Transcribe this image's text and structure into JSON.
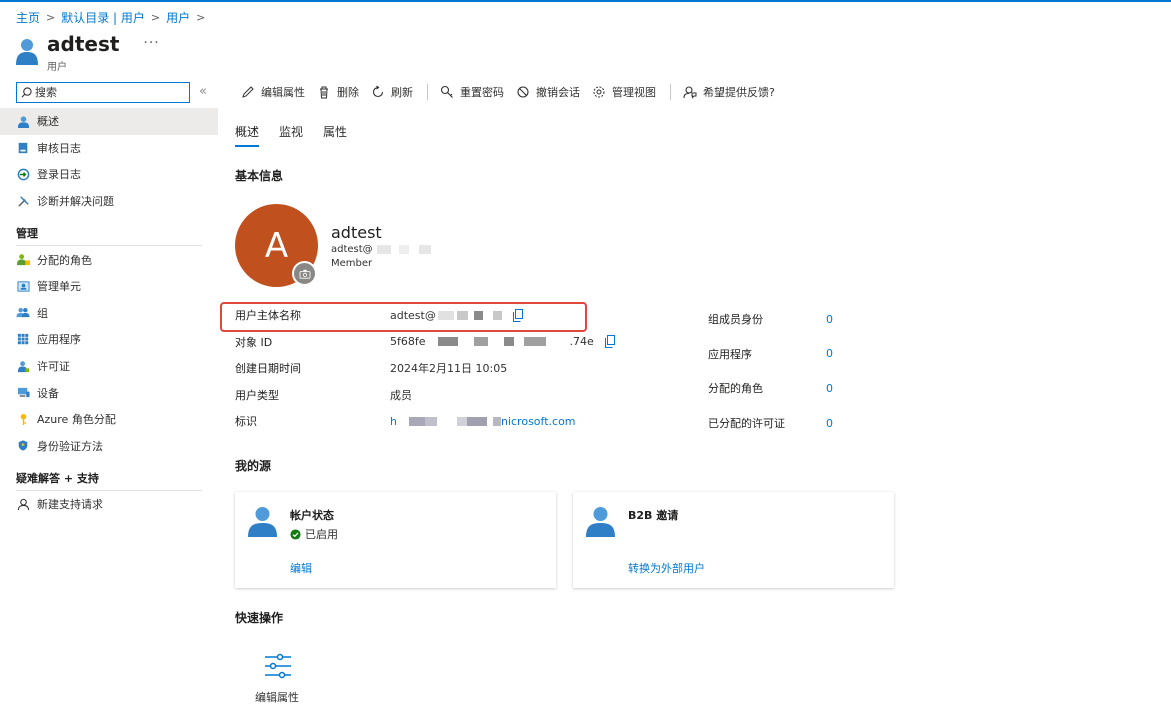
{
  "breadcrumb": [
    {
      "label": "主页"
    },
    {
      "label": "默认目录 | 用户"
    },
    {
      "label": "用户"
    }
  ],
  "header": {
    "title": "adtest",
    "subtitle": "用户",
    "more": "..."
  },
  "search": {
    "placeholder": "搜索"
  },
  "nav": {
    "collapse": "«",
    "top_items": [
      {
        "label": "概述",
        "icon": "user-icon",
        "active": true
      },
      {
        "label": "审核日志",
        "icon": "audit-log-icon"
      },
      {
        "label": "登录日志",
        "icon": "signin-log-icon"
      },
      {
        "label": "诊断并解决问题",
        "icon": "wrench-icon"
      }
    ],
    "manage_title": "管理",
    "manage_items": [
      {
        "label": "分配的角色",
        "icon": "assigned-roles-icon"
      },
      {
        "label": "管理单元",
        "icon": "admin-unit-icon"
      },
      {
        "label": "组",
        "icon": "groups-icon"
      },
      {
        "label": "应用程序",
        "icon": "apps-grid-icon"
      },
      {
        "label": "许可证",
        "icon": "license-icon"
      },
      {
        "label": "设备",
        "icon": "device-icon"
      },
      {
        "label": "Azure 角色分配",
        "icon": "key-icon"
      },
      {
        "label": "身份验证方法",
        "icon": "shield-icon"
      }
    ],
    "support_title": "疑难解答 + 支持",
    "support_items": [
      {
        "label": "新建支持请求",
        "icon": "support-person-icon"
      }
    ]
  },
  "toolbar": {
    "edit": "编辑属性",
    "delete": "删除",
    "refresh": "刷新",
    "reset_password": "重置密码",
    "revoke_sessions": "撤销会话",
    "manage_view": "管理视图",
    "feedback": "希望提供反馈?"
  },
  "tabs": [
    "概述",
    "监视",
    "属性"
  ],
  "basic_info": {
    "title": "基本信息",
    "avatar_letter": "A",
    "name": "adtest",
    "email_prefix": "adtest@",
    "member": "Member"
  },
  "properties": [
    {
      "key": "用户主体名称",
      "value_prefix": "adtest@",
      "value_suffix": "",
      "copy": true
    },
    {
      "key": "对象 ID",
      "value_prefix": "5f68fe",
      "value_suffix": ".74e",
      "copy": true
    },
    {
      "key": "创建日期时间",
      "value_prefix": "2024年2月11日 10:05",
      "value_suffix": ""
    },
    {
      "key": "用户类型",
      "value_prefix": "成员",
      "value_suffix": ""
    },
    {
      "key": "标识",
      "value_prefix": "h",
      "value_suffix": "nicrosoft.com",
      "link": true
    }
  ],
  "stats": [
    {
      "key": "组成员身份",
      "value": "0"
    },
    {
      "key": "应用程序",
      "value": "0"
    },
    {
      "key": "分配的角色",
      "value": "0"
    },
    {
      "key": "已分配的许可证",
      "value": "0"
    }
  ],
  "my_feed": {
    "title": "我的源",
    "account_card": {
      "title": "帐户状态",
      "status": "已启用",
      "link": "编辑"
    },
    "b2b_card": {
      "title": "B2B 邀请",
      "link": "转换为外部用户"
    }
  },
  "quick_actions": {
    "title": "快速操作",
    "edit": "编辑属性"
  },
  "colors": {
    "accent": "#0078d4",
    "avatar": "#c1501f",
    "highlight": "#e0483c",
    "success": "#107c10"
  }
}
